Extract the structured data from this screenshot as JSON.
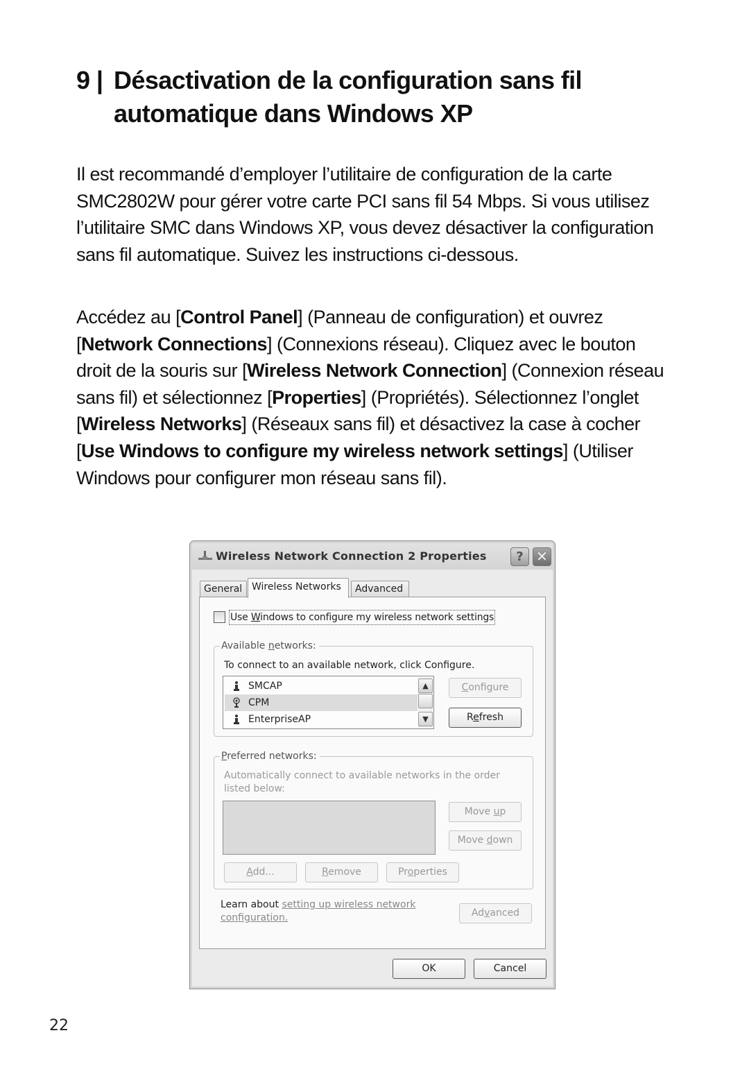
{
  "document": {
    "section_number": "9",
    "title": "Désactivation de la configuration sans fil automatique dans Windows XP",
    "paragraph1": "Il est recommandé d’employer l’utilitaire de configuration de la carte SMC2802W pour gérer votre carte PCI sans fil 54 Mbps. Si vous utilisez l’utilitaire SMC dans Windows XP, vous devez désactiver la configuration sans fil automatique. Suivez les instructions ci-dessous.",
    "paragraph2_parts": [
      {
        "text": "Accédez au [",
        "bold": false
      },
      {
        "text": "Control Panel",
        "bold": true
      },
      {
        "text": "] (Panneau de configuration) et ouvrez [",
        "bold": false
      },
      {
        "text": "Network Connections",
        "bold": true
      },
      {
        "text": "] (Connexions réseau). Cliquez avec le bouton droit de la souris sur [",
        "bold": false
      },
      {
        "text": "Wireless Network Connection",
        "bold": true
      },
      {
        "text": "] (Connexion réseau sans fil) et sélectionnez [",
        "bold": false
      },
      {
        "text": "Properties",
        "bold": true
      },
      {
        "text": "] (Propriétés). Sélectionnez l’onglet [",
        "bold": false
      },
      {
        "text": "Wireless Networks",
        "bold": true
      },
      {
        "text": "] (Réseaux sans fil) et désactivez la case à cocher [",
        "bold": false
      },
      {
        "text": "Use Windows to configure my wireless network settings",
        "bold": true
      },
      {
        "text": "] (Utiliser Windows pour configurer mon réseau sans fil).",
        "bold": false
      }
    ],
    "page_number": "22"
  },
  "dialog": {
    "title": "Wireless Network Connection 2 Properties",
    "title_icon": "network-connection-icon",
    "help_button": "?",
    "close_button": "✕",
    "tabs": [
      {
        "label": "General",
        "active": false
      },
      {
        "label": "Wireless Networks",
        "active": true
      },
      {
        "label": "Advanced",
        "active": false
      }
    ],
    "use_windows_checkbox": {
      "label_pre": "Use ",
      "label_accel": "W",
      "label_post": "indows to configure my wireless network settings",
      "checked": false
    },
    "available": {
      "legend_pre": "Available ",
      "legend_accel": "n",
      "legend_post": "etworks:",
      "hint": "To connect to an available network, click Configure.",
      "networks": [
        {
          "name": "SMCAP",
          "icon": "infrastructure-ap-icon",
          "selected": false
        },
        {
          "name": "CPM",
          "icon": "wireless-antenna-icon",
          "selected": true
        },
        {
          "name": "EnterpriseAP",
          "icon": "infrastructure-ap-icon",
          "selected": false
        }
      ],
      "scroll_up": "▲",
      "scroll_down": "▼",
      "configure_pre": "",
      "configure_accel": "C",
      "configure_post": "onfigure",
      "refresh_pre": "R",
      "refresh_accel": "e",
      "refresh_post": "fresh"
    },
    "preferred": {
      "legend_accel": "P",
      "legend_post": "referred networks:",
      "hint": "Automatically connect to available networks in the order listed below:",
      "moveup_pre": "Move ",
      "moveup_accel": "u",
      "moveup_post": "p",
      "movedown_pre": "Move ",
      "movedown_accel": "d",
      "movedown_post": "own",
      "add_accel": "A",
      "add_post": "dd...",
      "remove_accel": "R",
      "remove_post": "emove",
      "properties_pre": "Pr",
      "properties_accel": "o",
      "properties_post": "perties"
    },
    "learn": {
      "prefix": "Learn about ",
      "link": "setting up wireless network configuration."
    },
    "advanced_pre": "Ad",
    "advanced_accel": "v",
    "advanced_post": "anced",
    "ok": "OK",
    "cancel": "Cancel"
  }
}
